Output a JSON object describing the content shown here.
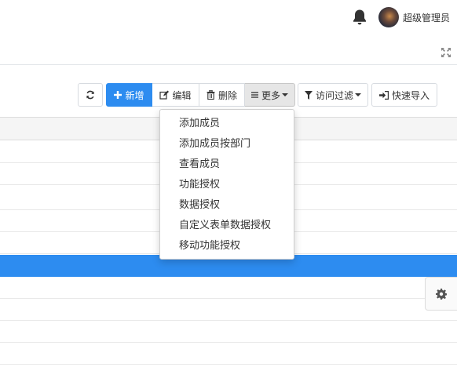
{
  "header": {
    "username": "超级管理员",
    "bell_icon": "bell-icon",
    "expand_icon": "expand-icon"
  },
  "toolbar": {
    "refresh_icon": "refresh-icon",
    "add_label": "新增",
    "edit_label": "编辑",
    "delete_label": "删除",
    "more_label": "更多",
    "filter_label": "访问过滤",
    "import_label": "快速导入"
  },
  "more_menu": {
    "items": [
      {
        "label": "添加成员"
      },
      {
        "label": "添加成员按部门"
      },
      {
        "label": "查看成员"
      },
      {
        "label": "功能授权"
      },
      {
        "label": "数据授权"
      },
      {
        "label": "自定义表单数据授权"
      },
      {
        "label": "移动功能授权"
      }
    ]
  },
  "colors": {
    "accent": "#2d8cf0",
    "selected_row": "#2d8cf0"
  }
}
